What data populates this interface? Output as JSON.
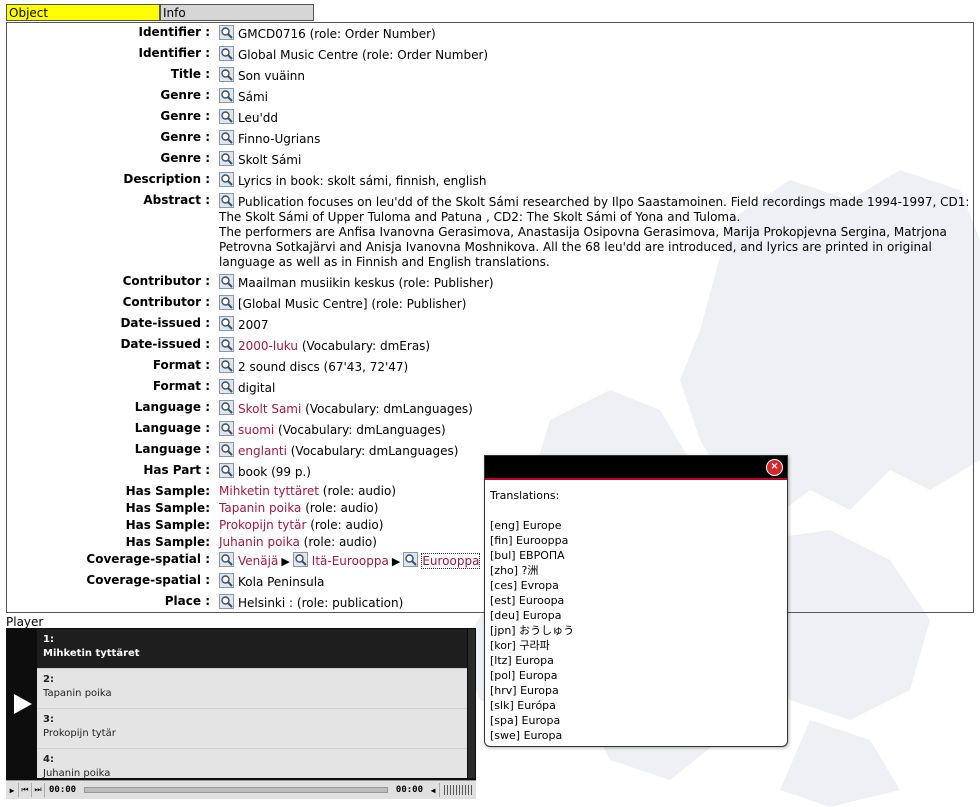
{
  "tabs": {
    "object": "Object",
    "info": "Info"
  },
  "rows": [
    {
      "label": "Identifier :",
      "parts": [
        {
          "t": "GMCD0716 (role: Order Number)"
        }
      ],
      "icon": true
    },
    {
      "label": "Identifier :",
      "parts": [
        {
          "t": "Global Music Centre (role: Order Number)"
        }
      ],
      "icon": true
    },
    {
      "label": "Title :",
      "parts": [
        {
          "t": "Son vuäinn"
        }
      ],
      "icon": true
    },
    {
      "label": "Genre :",
      "parts": [
        {
          "t": "Sámi"
        }
      ],
      "icon": true
    },
    {
      "label": "Genre :",
      "parts": [
        {
          "t": "Leu'dd"
        }
      ],
      "icon": true
    },
    {
      "label": "Genre :",
      "parts": [
        {
          "t": "Finno-Ugrians"
        }
      ],
      "icon": true
    },
    {
      "label": "Genre :",
      "parts": [
        {
          "t": "Skolt Sámi"
        }
      ],
      "icon": true
    },
    {
      "label": "Description :",
      "parts": [
        {
          "t": "Lyrics in book: skolt sámi, finnish, english"
        }
      ],
      "icon": true
    },
    {
      "label": "Abstract :",
      "parts": [
        {
          "t": "Publication focuses on leu'dd of the Skolt Sámi researched by Ilpo Saastamoinen. Field recordings made 1994-1997, CD1: The Skolt Sámi of Upper Tuloma and Patuna , CD2: The Skolt Sámi of Yona and Tuloma."
        },
        {
          "br": true
        },
        {
          "t": "The performers are Anfisa Ivanovna Gerasimova, Anastasija Osipovna Gerasimova, Marija Prokopjevna Sergina, Matrjona Petrovna Sotkajärvi and Anisja Ivanovna Moshnikova. All the 68 leu'dd are introduced, and lyrics are printed in original language as well as in Finnish and English translations."
        }
      ],
      "icon": true
    },
    {
      "label": "Contributor :",
      "parts": [
        {
          "t": "Maailman musiikin keskus (role: Publisher)"
        }
      ],
      "icon": true
    },
    {
      "label": "Contributor :",
      "parts": [
        {
          "t": "[Global Music Centre] (role: Publisher)"
        }
      ],
      "icon": true
    },
    {
      "label": "Date-issued :",
      "parts": [
        {
          "t": "2007"
        }
      ],
      "icon": true
    },
    {
      "label": "Date-issued :",
      "parts": [
        {
          "t": "2000-luku",
          "link": true
        },
        {
          "t": " (Vocabulary: dmEras)"
        }
      ],
      "icon": true
    },
    {
      "label": "Format :",
      "parts": [
        {
          "t": "2 sound discs (67'43, 72'47)"
        }
      ],
      "icon": true
    },
    {
      "label": "Format :",
      "parts": [
        {
          "t": "digital"
        }
      ],
      "icon": true
    },
    {
      "label": "Language :",
      "parts": [
        {
          "t": "Skolt Sami",
          "link": true
        },
        {
          "t": " (Vocabulary: dmLanguages)"
        }
      ],
      "icon": true
    },
    {
      "label": "Language :",
      "parts": [
        {
          "t": "suomi",
          "link": true
        },
        {
          "t": " (Vocabulary: dmLanguages)"
        }
      ],
      "icon": true
    },
    {
      "label": "Language :",
      "parts": [
        {
          "t": "englanti",
          "link": true
        },
        {
          "t": " (Vocabulary: dmLanguages)"
        }
      ],
      "icon": true
    },
    {
      "label": "Has Part :",
      "parts": [
        {
          "t": "book (99 p.)"
        }
      ],
      "icon": true
    },
    {
      "label": "Has Sample:",
      "parts": [
        {
          "t": "Mihketin tyttäret",
          "link": true
        },
        {
          "t": " (role: audio)"
        }
      ],
      "icon": false
    },
    {
      "label": "Has Sample:",
      "parts": [
        {
          "t": "Tapanin poika",
          "link": true
        },
        {
          "t": " (role: audio)"
        }
      ],
      "icon": false
    },
    {
      "label": "Has Sample:",
      "parts": [
        {
          "t": "Prokopijn tytär",
          "link": true
        },
        {
          "t": " (role: audio)"
        }
      ],
      "icon": false
    },
    {
      "label": "Has Sample:",
      "parts": [
        {
          "t": "Juhanin poika",
          "link": true
        },
        {
          "t": " (role: audio)"
        }
      ],
      "icon": false
    },
    {
      "label": "Coverage-spatial :",
      "parts": [
        {
          "t": "Venäjä",
          "link": true,
          "icon": true
        },
        {
          "arrow": "▶"
        },
        {
          "t": "Itä-Eurooppa",
          "link": true,
          "icon": true
        },
        {
          "arrow": "▶"
        },
        {
          "t": "Eurooppa",
          "link": true,
          "icon": true,
          "boxed": true
        }
      ],
      "icon": false
    },
    {
      "label": "Coverage-spatial :",
      "parts": [
        {
          "t": "Kola Peninsula"
        }
      ],
      "icon": true
    },
    {
      "label": "Place :",
      "parts": [
        {
          "t": "Helsinki : (role: publication)"
        }
      ],
      "icon": true
    }
  ],
  "player": {
    "label": "Player",
    "items": [
      {
        "num": "1:",
        "title": "Mihketin tyttäret",
        "active": true
      },
      {
        "num": "2:",
        "title": "Tapanin poika"
      },
      {
        "num": "3:",
        "title": "Prokopijn tytär"
      },
      {
        "num": "4:",
        "title": "Juhanin poika"
      }
    ],
    "time_current": "00:00",
    "time_total": "00:00"
  },
  "popup": {
    "title": "Translations:",
    "close_label": "×",
    "items": [
      {
        "code": "[eng]",
        "text": "Europe"
      },
      {
        "code": "[fin]",
        "text": "Eurooppa"
      },
      {
        "code": "[bul]",
        "text": "ЕВРОПА"
      },
      {
        "code": "[zho]",
        "text": "?洲"
      },
      {
        "code": "[ces]",
        "text": "Evropa"
      },
      {
        "code": "[est]",
        "text": "Euroopa"
      },
      {
        "code": "[deu]",
        "text": "Europa"
      },
      {
        "code": "[jpn]",
        "text": "おうしゅう"
      },
      {
        "code": "[kor]",
        "text": "구라파"
      },
      {
        "code": "[ltz]",
        "text": "Europa"
      },
      {
        "code": "[pol]",
        "text": "Europa"
      },
      {
        "code": "[hrv]",
        "text": "Europa"
      },
      {
        "code": "[slk]",
        "text": "Európa"
      },
      {
        "code": "[spa]",
        "text": "Europa"
      },
      {
        "code": "[swe]",
        "text": "Europa"
      }
    ]
  },
  "colors": {
    "tab_active": "#ffff00",
    "tab_inactive": "#d6d6d6",
    "link": "#9b1b40",
    "popup_head": "#000000",
    "popup_close": "#d8262f"
  }
}
